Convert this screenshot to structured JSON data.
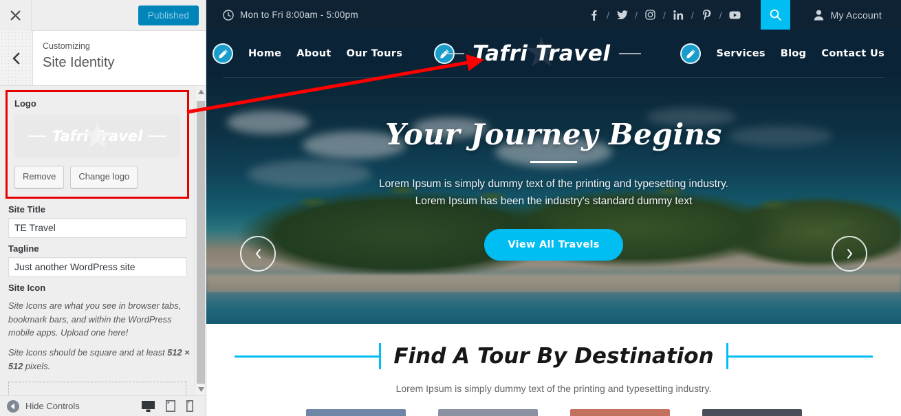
{
  "customizer": {
    "close_icon": "close-icon",
    "publish_label": "Published",
    "back_icon": "chevron-left-icon",
    "kicker": "Customizing",
    "title": "Site Identity",
    "logo": {
      "label": "Logo",
      "preview_text": "Tafri Travel",
      "remove_label": "Remove",
      "change_label": "Change logo"
    },
    "site_title": {
      "label": "Site Title",
      "value": "TE Travel"
    },
    "tagline": {
      "label": "Tagline",
      "value": "Just another WordPress site"
    },
    "site_icon": {
      "label": "Site Icon",
      "desc1": "Site Icons are what you see in browser tabs, bookmark bars, and within the WordPress mobile apps. Upload one here!",
      "desc2_pre": "Site Icons should be square and at least ",
      "desc2_bold": "512 × 512",
      "desc2_post": " pixels."
    },
    "footer": {
      "hide_controls": "Hide Controls",
      "devices": [
        "desktop-preview-icon",
        "tablet-preview-icon",
        "mobile-preview-icon"
      ]
    },
    "accent_blue": "#0085ba",
    "highlight_red": "#e80000"
  },
  "site": {
    "topbar": {
      "clock_icon": "clock-icon",
      "hours": "Mon to Fri 8:00am - 5:00pm",
      "socials": [
        "facebook-icon",
        "twitter-icon",
        "instagram-icon",
        "linkedin-icon",
        "pinterest-icon",
        "youtube-icon"
      ],
      "separator": "/",
      "search_icon": "search-icon",
      "account_icon": "user-icon",
      "account_label": "My Account"
    },
    "nav": {
      "edit_icon": "pencil-edit-icon",
      "left_links": [
        "Home",
        "About",
        "Our Tours"
      ],
      "right_links": [
        "Services",
        "Blog",
        "Contact Us"
      ],
      "brand": "Tafri Travel"
    },
    "hero": {
      "title": "Your Journey Begins",
      "subtitle": "Lorem Ipsum is simply dummy text of the printing and typesetting industry. Lorem Ipsum has been the industry's standard dummy text",
      "button": "View All Travels",
      "prev_icon": "chevron-left-icon",
      "next_icon": "chevron-right-icon"
    },
    "find": {
      "title": "Find A Tour By Destination",
      "subtitle": "Lorem Ipsum is simply dummy text of the printing and typesetting industry.",
      "card_colors": [
        "#6f86a6",
        "#8b93a3",
        "#c4705e",
        "#4a4f59"
      ]
    },
    "colors": {
      "cyan": "#00bdf2",
      "navy": "#0b2337",
      "topbar_navy": "#0e2233"
    }
  }
}
